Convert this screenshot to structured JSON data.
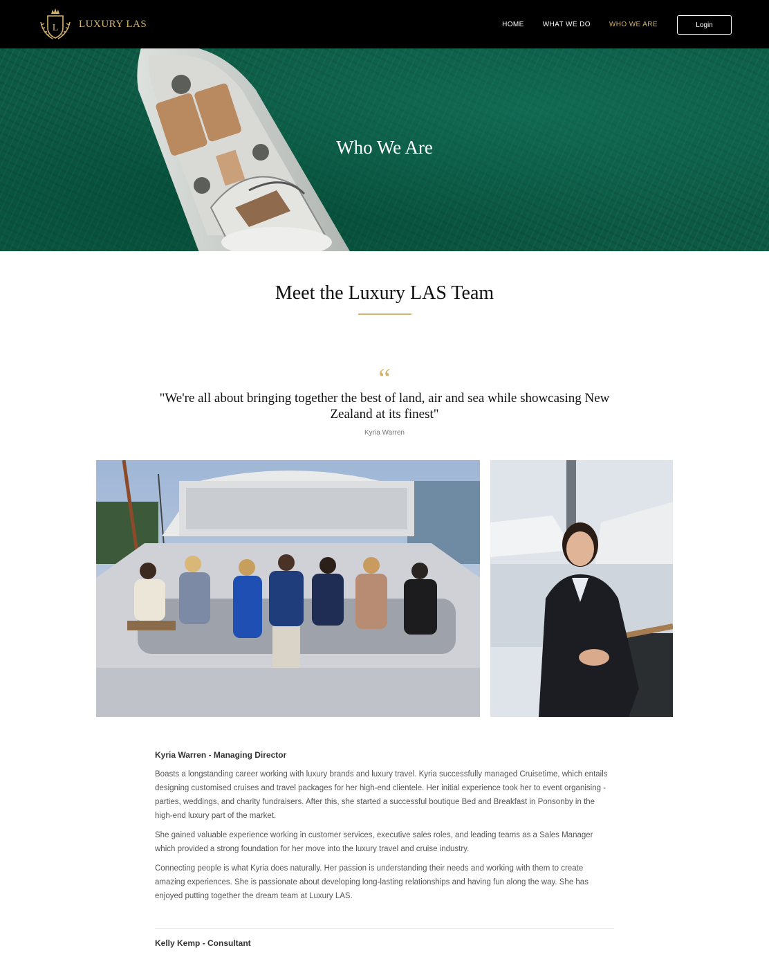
{
  "brand": {
    "name": "LUXURY LAS",
    "accent": "#d4b36a"
  },
  "nav": {
    "items": [
      {
        "label": "HOME",
        "active": false
      },
      {
        "label": "WHAT WE DO",
        "active": false
      },
      {
        "label": "WHO WE ARE",
        "active": true
      }
    ],
    "login_label": "Login"
  },
  "hero": {
    "title": "Who We Are"
  },
  "team": {
    "heading": "Meet the Luxury LAS Team"
  },
  "quote": {
    "mark": "“",
    "text": "\"We're all about bringing together the best of land, air and sea while showcasing New Zealand at its finest\"",
    "author": "Kyria Warren"
  },
  "bios": [
    {
      "name": "Kyria Warren - Managing Director",
      "paragraphs": [
        "Boasts a longstanding career working with luxury brands and luxury travel. Kyria successfully managed Cruisetime, which entails designing customised cruises and travel packages for her high-end clientele. Her initial experience took her to event organising - parties, weddings, and charity fundraisers. After this, she started a successful boutique Bed and Breakfast in Ponsonby in the high-end luxury part of the market.",
        "She gained valuable experience working in customer services, executive sales roles, and leading teams as a Sales Manager which provided a strong foundation for her move into the luxury travel and cruise industry.",
        "Connecting people is what Kyria does naturally. Her passion is understanding their needs and working with them to create amazing experiences. She is passionate about developing long-lasting relationships and having fun along the way. She has enjoyed putting together the dream team at Luxury LAS."
      ]
    },
    {
      "name": "Kelly Kemp - Consultant"
    }
  ]
}
